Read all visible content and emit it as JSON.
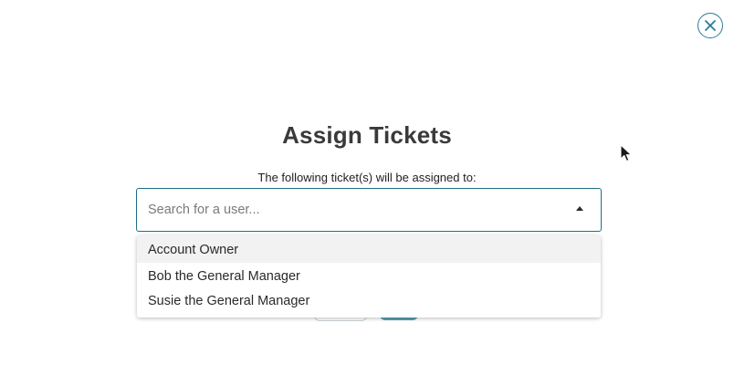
{
  "modal": {
    "title": "Assign Tickets",
    "subtitle": "The following ticket(s) will be assigned to:",
    "close_icon": "close-circle-icon",
    "accent_color": "#1e6f87"
  },
  "search": {
    "placeholder": "Search for a user...",
    "value": "",
    "toggle_icon": "caret-up-icon"
  },
  "dropdown": {
    "options": [
      {
        "label": "Account Owner",
        "highlighted": true
      },
      {
        "label": "Bob the General Manager",
        "highlighted": false
      },
      {
        "label": "Susie the General Manager",
        "highlighted": false
      }
    ]
  }
}
